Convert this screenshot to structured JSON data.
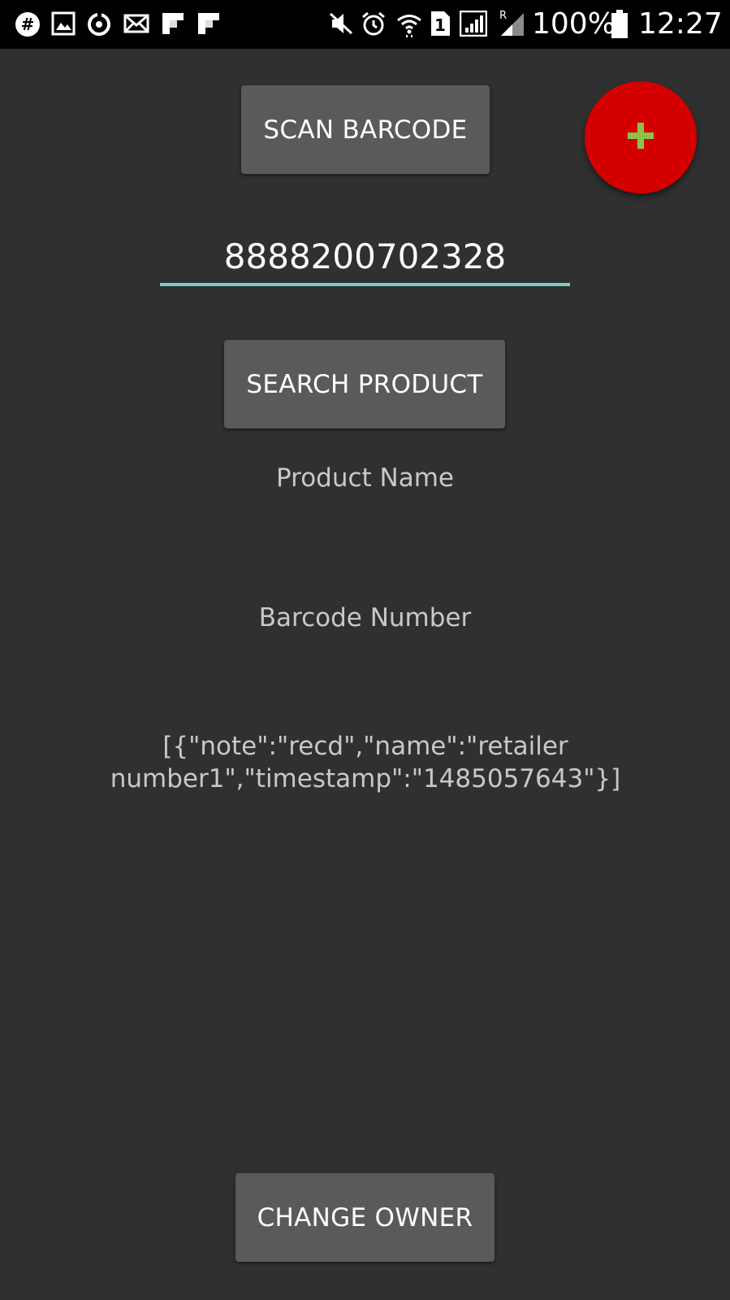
{
  "status_bar": {
    "battery_percent": "100%",
    "time": "12:27",
    "sim_slot": "1",
    "roaming_indicator": "R",
    "left_icons": [
      "slack-icon",
      "gallery-icon",
      "sync-icon",
      "mail-icon",
      "flipboard-icon",
      "flipboard-icon"
    ],
    "right_icons": [
      "mute-icon",
      "alarm-icon",
      "wifi-icon",
      "sim-icon",
      "signal-icon",
      "signal-roaming-icon",
      "battery-icon"
    ]
  },
  "buttons": {
    "scan_barcode": "SCAN BARCODE",
    "search_product": "SEARCH PRODUCT",
    "change_owner": "CHANGE OWNER"
  },
  "fab": {
    "icon": "plus-icon",
    "background": "#d40000",
    "icon_color": "#8bc34a"
  },
  "barcode_field": {
    "value": "8888200702328",
    "underline_color": "#80cbc4"
  },
  "product": {
    "name_label": "Product Name",
    "barcode_label": "Barcode Number",
    "history_json": "[{\"note\":\"recd\",\"name\":\"retailer number1\",\"timestamp\":\"1485057643\"}]"
  },
  "colors": {
    "background": "#303030",
    "button_bg": "#5a5a5a",
    "status_bar_bg": "#000000"
  }
}
